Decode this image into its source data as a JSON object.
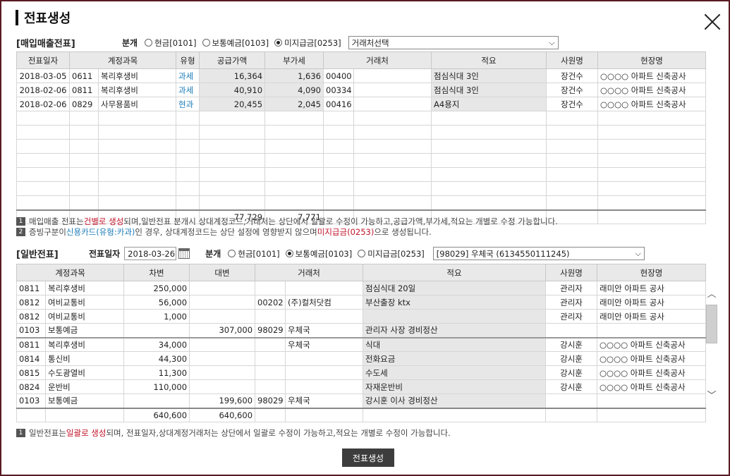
{
  "dialog": {
    "title": "전표생성",
    "close": "✕"
  },
  "purchase": {
    "section_title": "[매입매출전표]",
    "type_label": "분개",
    "radios": [
      {
        "label": "현금[0101]",
        "selected": false
      },
      {
        "label": "보통예금[0103]",
        "selected": false
      },
      {
        "label": "미지급금[0253]",
        "selected": true
      }
    ],
    "partner_select": "거래처선택",
    "headers": [
      "전표일자",
      "계정과목",
      "유형",
      "공급가액",
      "부가세",
      "거래처",
      "적요",
      "사원명",
      "현장명"
    ],
    "rows": [
      {
        "date": "2018-03-05",
        "code": "0611",
        "account": "복리후생비",
        "type": "과세",
        "supply": "16,364",
        "vat": "1,636",
        "pcode": "00400",
        "pname": "",
        "memo": "점심식대 3인",
        "staff": "장건수",
        "site": "○○○○ 아파트 신축공사"
      },
      {
        "date": "2018-02-06",
        "code": "0811",
        "account": "복리후생비",
        "type": "과세",
        "supply": "40,910",
        "vat": "4,090",
        "pcode": "00334",
        "pname": "",
        "memo": "점심식대 3인",
        "staff": "장건수",
        "site": "○○○○ 아파트 신축공사"
      },
      {
        "date": "2018-02-06",
        "code": "0829",
        "account": "사무용품비",
        "type": "현과",
        "supply": "20,455",
        "vat": "2,045",
        "pcode": "00416",
        "pname": "",
        "memo": "A4용지",
        "staff": "장건수",
        "site": "○○○○ 아파트 신축공사"
      }
    ],
    "total_supply": "77,729",
    "total_vat": "7,771",
    "notes": [
      {
        "num": "1",
        "pre": "매입매출 전표는 ",
        "hl": "건별로 생성",
        "post": "되며,일반전표 분개시 상대계정코드,거래처는 상단에서 일괄로 수정이 가능하고,공급가액,부가세,적요는 개별로 수정 가능합니다."
      },
      {
        "num": "2",
        "pre": "증빙구분이 ",
        "hl_blue": "신용카드(유형:카과)",
        "mid": "인 경우, 상대계정코드는 상단 설정에 영향받지 않으며 ",
        "hl": "미지급금(0253)",
        "post": "으로 생성됩니다."
      }
    ]
  },
  "general": {
    "section_title": "[일반전표]",
    "date_label": "전표일자",
    "date_value": "2018-03-26",
    "type_label": "분개",
    "radios": [
      {
        "label": "현금[0101]",
        "selected": false
      },
      {
        "label": "보통예금[0103]",
        "selected": true
      },
      {
        "label": "미지급금[0253]",
        "selected": false
      }
    ],
    "partner_select": "[98029] 우체국 (6134550111245)",
    "headers": [
      "계정과목",
      "차변",
      "대변",
      "거래처",
      "적요",
      "사원명",
      "현장명"
    ],
    "rows": [
      {
        "code": "0811",
        "account": "복리후생비",
        "debit": "250,000",
        "credit": "",
        "pcode": "",
        "pname": "",
        "memo": "점심식대 20일",
        "staff": "관리자",
        "site": "래미안 아파트 공사"
      },
      {
        "code": "0812",
        "account": "여비교통비",
        "debit": "56,000",
        "credit": "",
        "pcode": "00202",
        "pname": "(주)컬처닷컴",
        "memo": "부산출장 ktx",
        "staff": "관리자",
        "site": "래미안 아파트 공사"
      },
      {
        "code": "0812",
        "account": "여비교통비",
        "debit": "1,000",
        "credit": "",
        "pcode": "",
        "pname": "",
        "memo": "",
        "staff": "관리자",
        "site": "래미안 아파트 공사"
      },
      {
        "code": "0103",
        "account": "보통예금",
        "debit": "",
        "credit": "307,000",
        "pcode": "98029",
        "pname": "우체국",
        "memo": "관리자 사장 경비정산",
        "staff": "",
        "site": ""
      },
      {
        "code": "0811",
        "account": "복리후생비",
        "debit": "34,000",
        "credit": "",
        "pcode": "",
        "pname": "우체국",
        "memo": "식대",
        "staff": "강시훈",
        "site": "○○○○ 아파트 신축공사"
      },
      {
        "code": "0814",
        "account": "통신비",
        "debit": "44,300",
        "credit": "",
        "pcode": "",
        "pname": "",
        "memo": "전화요금",
        "staff": "강시훈",
        "site": "○○○○ 아파트 신축공사"
      },
      {
        "code": "0815",
        "account": "수도광열비",
        "debit": "11,300",
        "credit": "",
        "pcode": "",
        "pname": "",
        "memo": "수도세",
        "staff": "강시훈",
        "site": "○○○○ 아파트 신축공사"
      },
      {
        "code": "0824",
        "account": "운반비",
        "debit": "110,000",
        "credit": "",
        "pcode": "",
        "pname": "",
        "memo": "자재운반비",
        "staff": "강시훈",
        "site": "○○○○ 아파트 신축공사"
      },
      {
        "code": "0103",
        "account": "보통예금",
        "debit": "",
        "credit": "199,600",
        "pcode": "98029",
        "pname": "우체국",
        "memo": "강시훈 이사 경비정산",
        "staff": "",
        "site": ""
      }
    ],
    "total_debit": "640,600",
    "total_credit": "640,600",
    "note": {
      "num": "1",
      "pre": "일반전표는 ",
      "hl": "일괄로 생성",
      "post": "되며, 전표일자,상대계정거래처는 상단에서 일괄로 수정이 가능하고,적요는 개별로 수정이 가능합니다."
    }
  },
  "scroll": {
    "up": "︿",
    "down": "﹀"
  },
  "generate_button": "전표생성"
}
